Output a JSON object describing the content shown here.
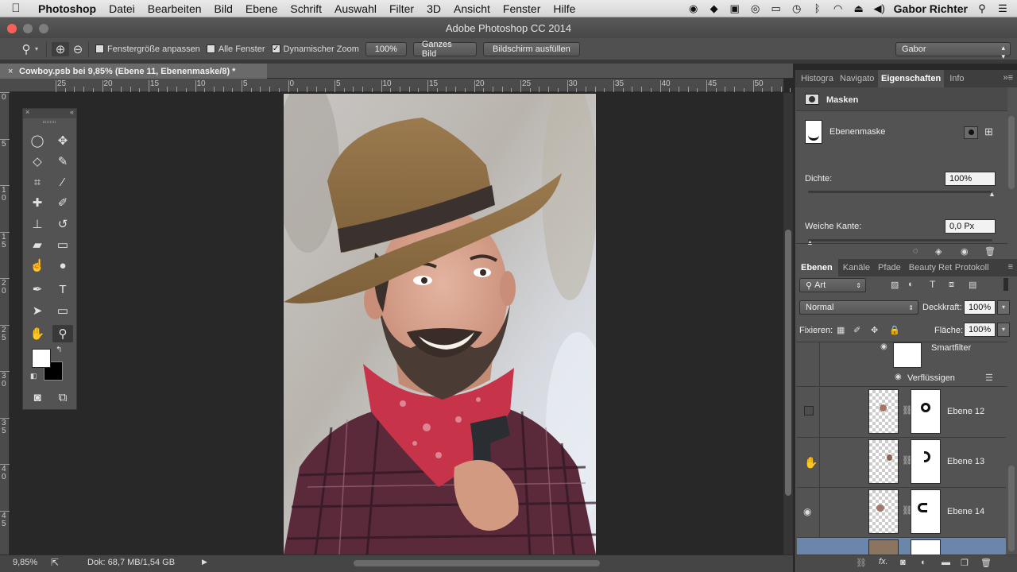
{
  "menubar": {
    "app": "Photoshop",
    "items": [
      "Datei",
      "Bearbeiten",
      "Bild",
      "Ebene",
      "Schrift",
      "Auswahl",
      "Filter",
      "3D",
      "Ansicht",
      "Fenster",
      "Hilfe"
    ],
    "user": "Gabor Richter"
  },
  "window": {
    "title": "Adobe Photoshop CC 2014"
  },
  "options": {
    "fit_window": "Fenstergröße anpassen",
    "all_windows": "Alle Fenster",
    "dynamic_zoom": "Dynamischer Zoom",
    "zoom_value": "100%",
    "fit_screen": "Ganzes Bild",
    "fill_screen": "Bildschirm ausfüllen",
    "workspace": "Gabor"
  },
  "document": {
    "tab_title": "Cowboy.psb bei 9,85% (Ebene 11, Ebenenmaske/8) *",
    "close": "×"
  },
  "ruler": {
    "h_labels": [
      "25",
      "20",
      "15",
      "10",
      "5",
      "0",
      "5",
      "10",
      "15",
      "20",
      "25",
      "30",
      "35",
      "40",
      "45",
      "50"
    ],
    "v_labels": [
      "0",
      "5",
      "1 0",
      "1 5",
      "2 0",
      "2 5",
      "3 0",
      "3 5",
      "4 0",
      "4 5"
    ]
  },
  "status": {
    "zoom": "9,85%",
    "doc_size": "Dok: 68,7 MB/1,54 GB"
  },
  "properties": {
    "tabs": [
      "Histogra",
      "Navigato",
      "Eigenschaften",
      "Info"
    ],
    "section": "Masken",
    "mask_type": "Ebenenmaske",
    "density_label": "Dichte:",
    "density_value": "100%",
    "density_level": 1.0,
    "feather_label": "Weiche Kante:",
    "feather_value": "0,0 Px",
    "feather_level": 0.0
  },
  "layers": {
    "tabs": [
      "Ebenen",
      "Kanäle",
      "Pfade",
      "Beauty Ret",
      "Protokoll"
    ],
    "filter_kind": "Art",
    "blend_mode": "Normal",
    "opacity_label": "Deckkraft:",
    "opacity_value": "100%",
    "lock_label": "Fixieren:",
    "fill_label": "Fläche:",
    "fill_value": "100%",
    "smartfilter": "Smartfilter",
    "liquify": "Verflüssigen",
    "rows": [
      {
        "name": "Ebene 12",
        "visible": false
      },
      {
        "name": "Ebene 13",
        "visible": true
      },
      {
        "name": "Ebene 14",
        "visible": true
      }
    ]
  }
}
